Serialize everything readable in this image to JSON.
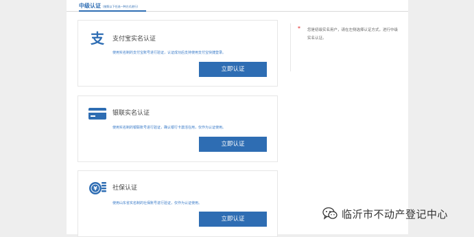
{
  "tab": {
    "title": "中级认证",
    "subtitle": "(按照以下任选一种方式进行)"
  },
  "cards": [
    {
      "icon": "alipay-icon",
      "title": "支付宝实名认证",
      "description": "使用实名制的支付宝账号进行验证，认证成功后支持使用支付宝快捷登录。",
      "button": "立即认证"
    },
    {
      "icon": "bank-card-icon",
      "title": "银联实名认证",
      "description": "使用实名制的银联账号进行验证，确认银行卡激活在用，仅作为认证使用。",
      "button": "立即认证"
    },
    {
      "icon": "social-security-icon",
      "title": "社保认证",
      "description": "使用山东省实名制的社保账号进行验证，仅作为认证使用。",
      "button": "立即认证"
    }
  ],
  "note": {
    "star": "*",
    "text": "您是初级实名用户，请在左侧选择认证方式，进行中级实名认证。"
  },
  "watermark": {
    "text": "临沂市不动产登记中心"
  },
  "colors": {
    "brand": "#2e6db3",
    "link": "#3a7bc8",
    "required": "#e02020",
    "background": "#eeeeee"
  }
}
